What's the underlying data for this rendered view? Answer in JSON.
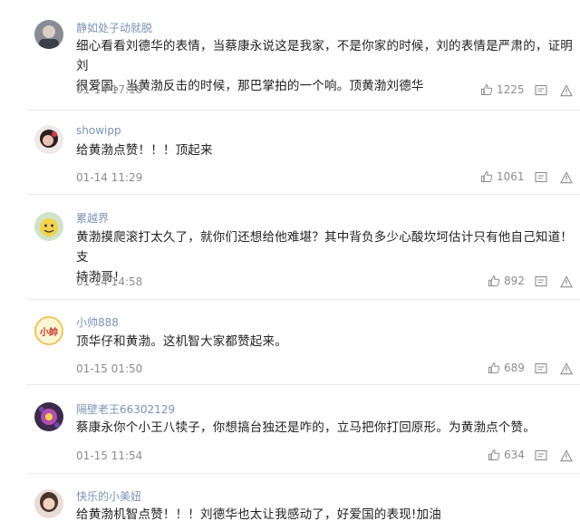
{
  "comments": [
    {
      "username": "静如处子动就脱",
      "text_line1": "细心看看刘德华的表情，当蔡康永说这是我家，不是你家的时候，刘的表情是严肃的，证明刘",
      "text_line2": "很爱国。当黄渤反击的时候，那巴掌拍的一个响。顶黄渤刘德华",
      "time": "01-14 17:18",
      "likes": "1225"
    },
    {
      "username": "showipp",
      "text_line1": "给黄渤点赞！！！顶起来",
      "text_line2": "",
      "time": "01-14 11:29",
      "likes": "1061"
    },
    {
      "username": "累越界",
      "text_line1": "黄渤摸爬滚打太久了，就你们还想给他难堪？其中背负多少心酸坎坷估计只有他自己知道！支",
      "text_line2": "持渤哥！",
      "time": "01-14 14:58",
      "likes": "892"
    },
    {
      "username": "小帅888",
      "avatar_text": "小帥",
      "text_line1": "顶华仔和黄渤。这机智大家都赞起来。",
      "text_line2": "",
      "time": "01-15 01:50",
      "likes": "689"
    },
    {
      "username": "隔壁老王66302129",
      "text_line1": "蔡康永你个小王八犊子，你想搞台独还是咋的，立马把你打回原形。为黄渤点个赞。",
      "text_line2": "",
      "time": "01-15 11:54",
      "likes": "634"
    },
    {
      "username": "快乐的小美妞",
      "text_line1": "给黄渤机智点赞！！！刘德华也太让我感动了，好爱国的表现!加油",
      "text_line2": "",
      "time": "",
      "likes": ""
    }
  ],
  "icons": {
    "like": "thumbs-up-icon",
    "reply": "comment-icon",
    "report": "warning-icon"
  },
  "colors": {
    "username": "#7a93b3",
    "meta": "#8c8c8c",
    "text": "#222222",
    "divider": "#e9e9e9"
  }
}
